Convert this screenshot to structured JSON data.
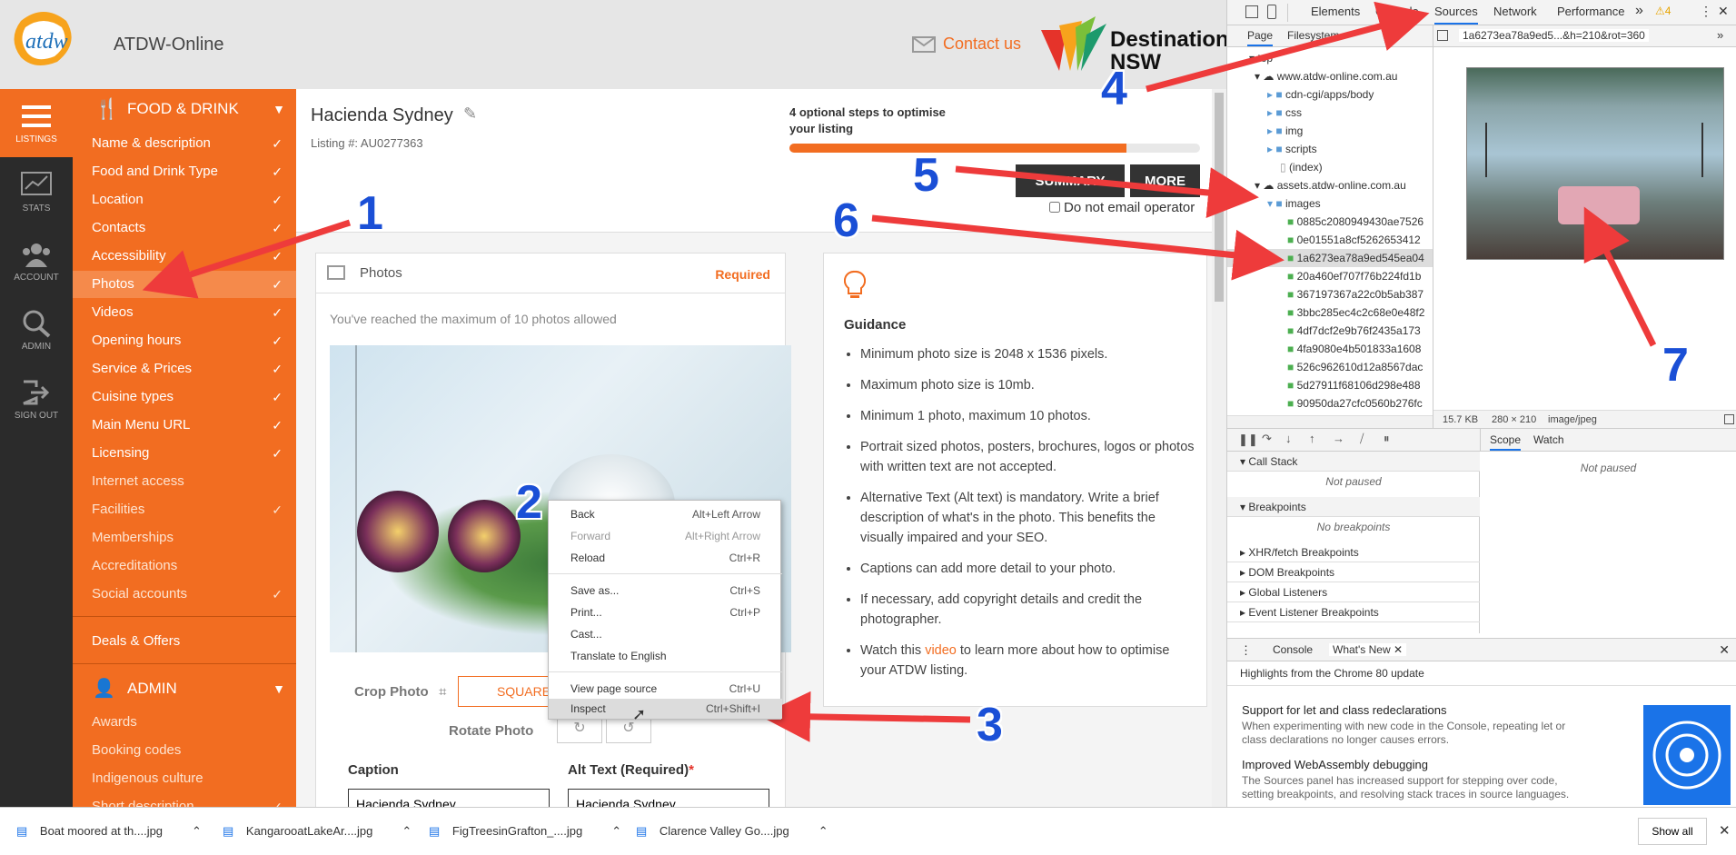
{
  "app": {
    "title": "ATDW-Online",
    "contact": "Contact us",
    "partner_line1": "Destination",
    "partner_line2": "NSW"
  },
  "rail": [
    {
      "label": "LISTINGS",
      "icon": "list-icon"
    },
    {
      "label": "STATS",
      "icon": "chart-icon"
    },
    {
      "label": "ACCOUNT",
      "icon": "users-icon"
    },
    {
      "label": "ADMIN",
      "icon": "search-icon"
    },
    {
      "label": "SIGN OUT",
      "icon": "sign-out-icon"
    }
  ],
  "sidebar": {
    "section_food": "FOOD & DRINK",
    "items": [
      {
        "label": "Name & description",
        "check": "✓"
      },
      {
        "label": "Food and Drink Type",
        "check": "✓"
      },
      {
        "label": "Location",
        "check": "✓"
      },
      {
        "label": "Contacts",
        "check": "✓"
      },
      {
        "label": "Accessibility",
        "check": "✓"
      },
      {
        "label": "Photos",
        "check": "✓"
      },
      {
        "label": "Videos",
        "check": "✓"
      },
      {
        "label": "Opening hours",
        "check": "✓"
      },
      {
        "label": "Service & Prices",
        "check": "✓"
      },
      {
        "label": "Cuisine types",
        "check": "✓"
      },
      {
        "label": "Main Menu URL",
        "check": "✓"
      },
      {
        "label": "Licensing",
        "check": "✓"
      },
      {
        "label": "Internet access",
        "check": ""
      },
      {
        "label": "Facilities",
        "check": "✓"
      },
      {
        "label": "Memberships",
        "check": ""
      },
      {
        "label": "Accreditations",
        "check": ""
      },
      {
        "label": "Social accounts",
        "check": "✓"
      }
    ],
    "deals": "Deals & Offers",
    "section_admin": "ADMIN",
    "admin_items": [
      {
        "label": "Awards",
        "check": ""
      },
      {
        "label": "Booking codes",
        "check": ""
      },
      {
        "label": "Indigenous culture",
        "check": ""
      },
      {
        "label": "Short description",
        "check": "✓"
      }
    ]
  },
  "listing": {
    "name": "Hacienda Sydney",
    "number": "Listing #: AU0277363",
    "optimise": "4 optional steps to optimise your listing",
    "progress": 0.82,
    "summary_btn": "SUMMARY",
    "more_btn": "MORE",
    "email_opt": "Do not email operator"
  },
  "photos": {
    "title": "Photos",
    "required": "Required",
    "max_msg": "You've reached the maximum of 10 photos allowed",
    "crop": "Crop Photo",
    "square": "SQUARE",
    "rotate": "Rotate Photo",
    "caption_label": "Caption",
    "alt_label": "Alt Text (Required)",
    "alt_star": "*",
    "caption_value": "Hacienda Sydney",
    "alt_value": "Hacienda Sydney"
  },
  "guidance": {
    "title": "Guidance",
    "items": [
      "Minimum photo size is 2048 x 1536 pixels.",
      "Maximum photo size is 10mb.",
      "Minimum 1 photo, maximum 10 photos.",
      "Portrait sized photos, posters, brochures, logos or photos with written text are not accepted.",
      "Alternative Text (Alt text) is mandatory. Write a brief description of what's in the photo. This benefits the visually impaired and your SEO.",
      "Captions can add more detail to your photo.",
      "If necessary, add copyright details and credit the photographer."
    ],
    "last_pre": "Watch this ",
    "last_link": "video",
    "last_post": " to learn more about how to optimise your ATDW listing."
  },
  "context_menu": [
    {
      "label": "Back",
      "shortcut": "Alt+Left Arrow"
    },
    {
      "label": "Forward",
      "shortcut": "Alt+Right Arrow"
    },
    {
      "label": "Reload",
      "shortcut": "Ctrl+R"
    },
    {
      "label": "Save as...",
      "shortcut": "Ctrl+S"
    },
    {
      "label": "Print...",
      "shortcut": "Ctrl+P"
    },
    {
      "label": "Cast...",
      "shortcut": ""
    },
    {
      "label": "Translate to English",
      "shortcut": ""
    },
    {
      "label": "View page source",
      "shortcut": "Ctrl+U"
    },
    {
      "label": "Inspect",
      "shortcut": "Ctrl+Shift+I"
    }
  ],
  "devtools": {
    "tabs": [
      "Elements",
      "Console",
      "Sources",
      "Network",
      "Performance"
    ],
    "more_tabs": "»",
    "warn_count": "4",
    "nav_tabs": [
      "Page",
      "Filesystem"
    ],
    "file_tab": "1a6273ea78a9ed5...&h=210&rot=360",
    "tree": [
      {
        "label": "top",
        "level": 0,
        "kind": "frame"
      },
      {
        "label": "www.atdw-online.com.au",
        "level": 1,
        "kind": "cloud"
      },
      {
        "label": "cdn-cgi/apps/body",
        "level": 2,
        "kind": "folder"
      },
      {
        "label": "css",
        "level": 2,
        "kind": "folder"
      },
      {
        "label": "img",
        "level": 2,
        "kind": "folder"
      },
      {
        "label": "scripts",
        "level": 2,
        "kind": "folder"
      },
      {
        "label": "(index)",
        "level": 2,
        "kind": "file"
      },
      {
        "label": "assets.atdw-online.com.au",
        "level": 1,
        "kind": "cloud"
      },
      {
        "label": "images",
        "level": 2,
        "kind": "folder"
      },
      {
        "label": "0885c2080949430ae7526",
        "level": 3,
        "kind": "img"
      },
      {
        "label": "0e01551a8cf5262653412",
        "level": 3,
        "kind": "img"
      },
      {
        "label": "1a6273ea78a9ed545ea04",
        "level": 3,
        "kind": "img",
        "selected": true
      },
      {
        "label": "20a460ef707f76b224fd1b",
        "level": 3,
        "kind": "img"
      },
      {
        "label": "367197367a22c0b5ab387",
        "level": 3,
        "kind": "img"
      },
      {
        "label": "3bbc285ec4c2c68e0e48f2",
        "level": 3,
        "kind": "img"
      },
      {
        "label": "4df7dcf2e9b76f2435a173",
        "level": 3,
        "kind": "img"
      },
      {
        "label": "4fa9080e4b501833a1608",
        "level": 3,
        "kind": "img"
      },
      {
        "label": "526c962610d12a8567dac",
        "level": 3,
        "kind": "img"
      },
      {
        "label": "5d27911f68106d298e488",
        "level": 3,
        "kind": "img"
      },
      {
        "label": "90950da27cfc0560b276fc",
        "level": 3,
        "kind": "img"
      }
    ],
    "img_info": {
      "size": "15.7 KB",
      "dims": "280 × 210",
      "mime": "image/jpeg"
    },
    "scope_tabs": [
      "Scope",
      "Watch"
    ],
    "not_paused": "Not paused",
    "sections": [
      {
        "label": "Call Stack",
        "open": true,
        "body": "Not paused"
      },
      {
        "label": "Breakpoints",
        "open": true,
        "body": "No breakpoints"
      },
      {
        "label": "XHR/fetch Breakpoints",
        "open": false
      },
      {
        "label": "DOM Breakpoints",
        "open": false
      },
      {
        "label": "Global Listeners",
        "open": false
      },
      {
        "label": "Event Listener Breakpoints",
        "open": false
      }
    ],
    "drawer_tabs": [
      "Console",
      "What's New"
    ],
    "whatsnew_header": "Highlights from the Chrome 80 update",
    "news": [
      {
        "title": "Support for let and class redeclarations",
        "body": "When experimenting with new code in the Console, repeating let or class declarations no longer causes errors."
      },
      {
        "title": "Improved WebAssembly debugging",
        "body": "The Sources panel has increased support for stepping over code, setting breakpoints, and resolving stack traces in source languages."
      }
    ]
  },
  "downloads": [
    "Boat moored at th....jpg",
    "KangarooatLakeAr....jpg",
    "FigTreesinGrafton_....jpg",
    "Clarence Valley Go....jpg"
  ],
  "show_all": "Show all",
  "annotations": [
    "1",
    "2",
    "3",
    "4",
    "5",
    "6",
    "7"
  ],
  "colors": {
    "accent": "#f26d21",
    "arrow": "#ee3b3b",
    "label": "#1a4fd6",
    "sidebar_dark": "#2b2b2b"
  }
}
